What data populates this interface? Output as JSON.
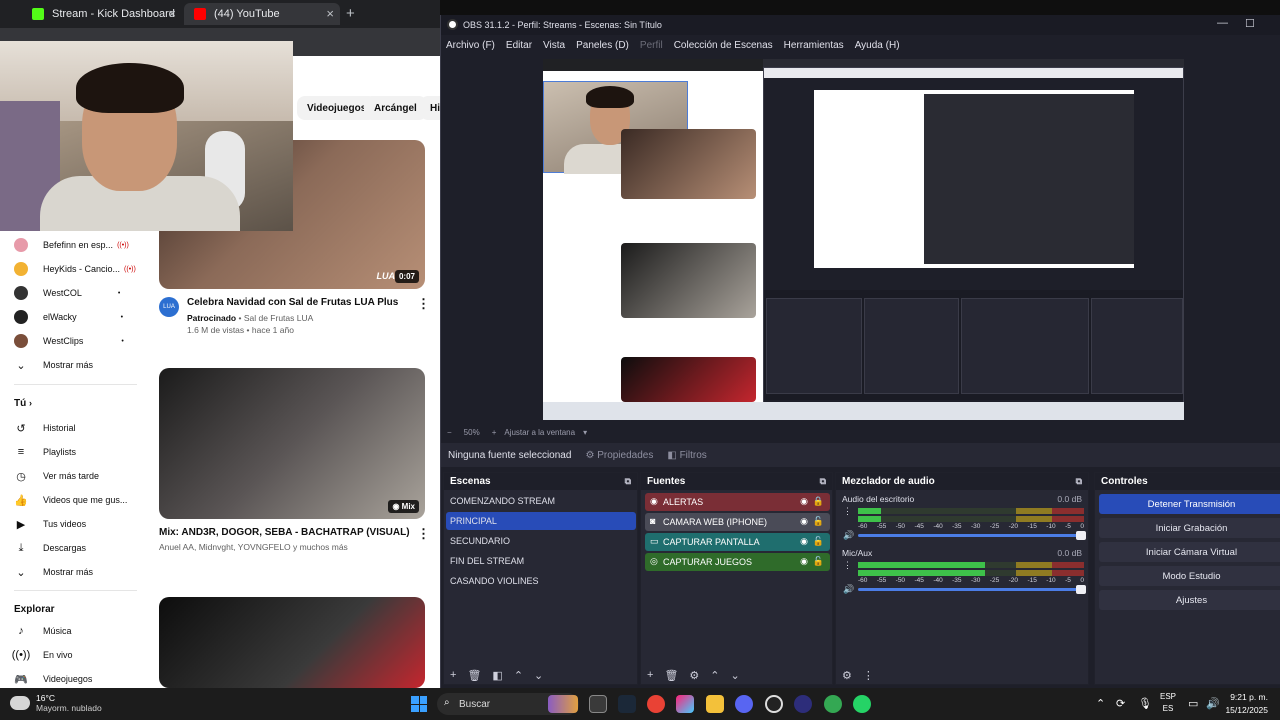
{
  "browser": {
    "tabs": [
      {
        "label": "Stream - Kick Dashboard",
        "color": "#53fc18"
      },
      {
        "label": "(44) YouTube",
        "color": "#ff0000"
      }
    ],
    "chips": [
      "Videojuegos",
      "Arcángel",
      "Hip"
    ],
    "subscriptions": [
      {
        "label": "Befefinn en esp...",
        "live": true,
        "color": "#e79aa9"
      },
      {
        "label": "HeyKids - Cancio...",
        "live": true,
        "color": "#f2b233"
      },
      {
        "label": "WestCOL",
        "live": false,
        "color": "#333333"
      },
      {
        "label": "elWacky",
        "live": false,
        "color": "#222222"
      },
      {
        "label": "WestClips",
        "live": false,
        "color": "#7a4e3a"
      }
    ],
    "show_more": "Mostrar más",
    "you_section": "Tú",
    "you_items": [
      "Historial",
      "Playlists",
      "Ver más tarde",
      "Videos que me gus...",
      "Tus videos",
      "Descargas"
    ],
    "show_more_2": "Mostrar más",
    "explore_title": "Explorar",
    "explore_items": [
      "Música",
      "En vivo",
      "Videojuegos"
    ],
    "videos": [
      {
        "title": "Celebra Navidad con Sal de Frutas LUA Plus",
        "channel_prefix": "Patrocinado",
        "channel": "Sal de Frutas LUA",
        "meta": "1.6 M de vistas • hace 1 año",
        "duration": "0:07"
      },
      {
        "title": "Mix: AND3R, DOGOR, SEBA - BACHATRAP (VISUAL)",
        "channel": "Anuel AA, Midnvght, YOVNGFELO y muchos más",
        "badge": "Mix"
      }
    ],
    "thumb1_watermark": "LUA"
  },
  "obs": {
    "title": "OBS 31.1.2 - Perfil: Streams - Escenas: Sin Título",
    "menu": [
      "Archivo (F)",
      "Editar",
      "Vista",
      "Paneles (D)",
      "Perfil",
      "Colección de Escenas",
      "Herramientas",
      "Ayuda (H)"
    ],
    "zoom": "50%",
    "fit": "Ajustar a la ventana",
    "no_source": "Ninguna fuente seleccionad",
    "properties": "Propiedades",
    "filters": "Filtros",
    "scenes_title": "Escenas",
    "scenes": [
      "COMENZANDO STREAM",
      "PRINCIPAL",
      "SECUNDARIO",
      "FIN DEL STREAM",
      "CASANDO VIOLINES"
    ],
    "sources_title": "Fuentes",
    "sources": [
      {
        "label": "ALERTAS",
        "color": "#7a2e36",
        "locked": true
      },
      {
        "label": "CAMARA WEB (IPHONE)",
        "color": "#4a4b57",
        "locked": false
      },
      {
        "label": "CAPTURAR PANTALLA",
        "color": "#1f6e6e",
        "locked": false
      },
      {
        "label": "CAPTURAR JUEGOS",
        "color": "#2f6b2a",
        "locked": false
      }
    ],
    "mixer_title": "Mezclador de audio",
    "channels": [
      {
        "name": "Audio del escritorio",
        "db": "0.0 dB",
        "level": 0.0
      },
      {
        "name": "Mic/Aux",
        "db": "0.0 dB",
        "level": 0.42
      }
    ],
    "scale": [
      "-60",
      "-55",
      "-50",
      "-45",
      "-40",
      "-35",
      "-30",
      "-25",
      "-20",
      "-15",
      "-10",
      "-5",
      "0"
    ],
    "controls_title": "Controles",
    "controls": [
      "Detener Transmisión",
      "Iniciar Grabación",
      "Iniciar Cámara Virtual",
      "Modo Estudio",
      "Ajustes"
    ]
  },
  "taskbar": {
    "temp": "16°C",
    "weather": "Mayorm. nublado",
    "search": "Buscar",
    "lang1": "ESP",
    "lang2": "ES",
    "time": "9:21 p. m.",
    "date": "15/12/2025"
  }
}
